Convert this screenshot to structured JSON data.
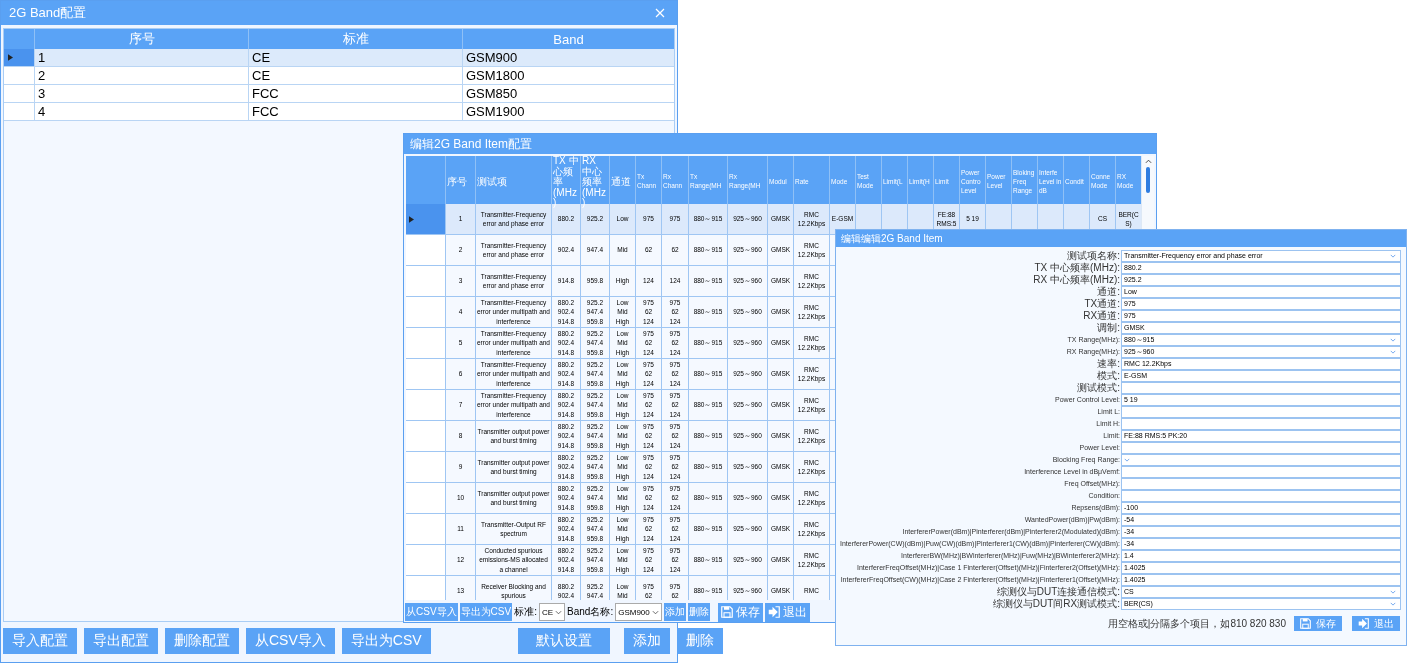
{
  "main_window": {
    "title": "2G Band配置",
    "table": {
      "columns": [
        "序号",
        "标准",
        "Band"
      ],
      "rows": [
        {
          "cells": [
            "1",
            "CE",
            "GSM900"
          ],
          "selected": true
        },
        {
          "cells": [
            "2",
            "CE",
            "GSM1800"
          ],
          "selected": false
        },
        {
          "cells": [
            "3",
            "FCC",
            "GSM850"
          ],
          "selected": false
        },
        {
          "cells": [
            "4",
            "FCC",
            "GSM1900"
          ],
          "selected": false
        }
      ]
    },
    "buttons": {
      "left": [
        "导入配置",
        "导出配置",
        "删除配置",
        "从CSV导入",
        "导出为CSV"
      ],
      "center": "默认设置",
      "right": [
        "添加",
        "删除"
      ]
    }
  },
  "item_window": {
    "title": "编辑2G Band Item配置",
    "table": {
      "columns": [
        "序号",
        "测试项",
        "TX 中心频率(MHz)",
        "RX 中心频率(MHz)",
        "通道",
        "Tx Chann",
        "Rx Chann",
        "Tx Range(MH",
        "Rx Range(MH",
        "Modul",
        "Rate",
        "Mode",
        "Test Mode",
        "Limit(L",
        "Limit(H",
        "Limit",
        "Power Contro Level",
        "Power Level",
        "Bloking Freq Range",
        "Interfe Level in dB",
        "Condit",
        "Conne Mode",
        "RX Mode"
      ],
      "rows": [
        {
          "selected": true,
          "cells": [
            "1",
            "Transmitter-Frequency error and phase error",
            "880.2",
            "925.2",
            "Low",
            "975",
            "975",
            "880～915",
            "925～960",
            "GMSK",
            "RMC 12.2Kbps",
            "E-GSM",
            null,
            null,
            null,
            "FE:88 RMS:5",
            "5 19",
            null,
            null,
            null,
            null,
            "CS",
            "BER(CS)"
          ]
        },
        {
          "selected": false,
          "cells": [
            "2",
            "Transmitter-Frequency error and phase error",
            "902.4",
            "947.4",
            "Mid",
            "62",
            "62",
            "880～915",
            "925～960",
            "GMSK",
            "RMC 12.2Kbps"
          ]
        },
        {
          "selected": false,
          "cells": [
            "3",
            "Transmitter-Frequency error and phase error",
            "914.8",
            "959.8",
            "High",
            "124",
            "124",
            "880～915",
            "925～960",
            "GMSK",
            "RMC 12.2Kbps"
          ]
        },
        {
          "selected": false,
          "cells": [
            "4",
            "Transmitter-Frequency error under multipath and interference",
            "880.2\n902.4\n914.8",
            "925.2\n947.4\n959.8",
            "Low\nMid\nHigh",
            "975\n62\n124",
            "975\n62\n124",
            "880～915",
            "925～960",
            "GMSK",
            "RMC 12.2Kbps"
          ]
        },
        {
          "selected": false,
          "cells": [
            "5",
            "Transmitter-Frequency error under multipath and interference",
            "880.2\n902.4\n914.8",
            "925.2\n947.4\n959.8",
            "Low\nMid\nHigh",
            "975\n62\n124",
            "975\n62\n124",
            "880～915",
            "925～960",
            "GMSK",
            "RMC 12.2Kbps"
          ]
        },
        {
          "selected": false,
          "cells": [
            "6",
            "Transmitter-Frequency error under multipath and interference",
            "880.2\n902.4\n914.8",
            "925.2\n947.4\n959.8",
            "Low\nMid\nHigh",
            "975\n62\n124",
            "975\n62\n124",
            "880～915",
            "925～960",
            "GMSK",
            "RMC 12.2Kbps"
          ]
        },
        {
          "selected": false,
          "cells": [
            "7",
            "Transmitter-Frequency error under multipath and interference",
            "880.2\n902.4\n914.8",
            "925.2\n947.4\n959.8",
            "Low\nMid\nHigh",
            "975\n62\n124",
            "975\n62\n124",
            "880～915",
            "925～960",
            "GMSK",
            "RMC 12.2Kbps"
          ]
        },
        {
          "selected": false,
          "cells": [
            "8",
            "Transmitter output power and burst timing",
            "880.2\n902.4\n914.8",
            "925.2\n947.4\n959.8",
            "Low\nMid\nHigh",
            "975\n62\n124",
            "975\n62\n124",
            "880～915",
            "925～960",
            "GMSK",
            "RMC 12.2Kbps"
          ]
        },
        {
          "selected": false,
          "cells": [
            "9",
            "Transmitter output power and burst timing",
            "880.2\n902.4\n914.8",
            "925.2\n947.4\n959.8",
            "Low\nMid\nHigh",
            "975\n62\n124",
            "975\n62\n124",
            "880～915",
            "925～960",
            "GMSK",
            "RMC 12.2Kbps"
          ]
        },
        {
          "selected": false,
          "cells": [
            "10",
            "Transmitter output power and burst timing",
            "880.2\n902.4\n914.8",
            "925.2\n947.4\n959.8",
            "Low\nMid\nHigh",
            "975\n62\n124",
            "975\n62\n124",
            "880～915",
            "925～960",
            "GMSK",
            "RMC 12.2Kbps"
          ]
        },
        {
          "selected": false,
          "cells": [
            "11",
            "Transmitter-Output RF spectrum",
            "880.2\n902.4\n914.8",
            "925.2\n947.4\n959.8",
            "Low\nMid\nHigh",
            "975\n62\n124",
            "975\n62\n124",
            "880～915",
            "925～960",
            "GMSK",
            "RMC 12.2Kbps"
          ]
        },
        {
          "selected": false,
          "cells": [
            "12",
            "Conducted spurious emissions-MS allocated a channel",
            "880.2\n902.4\n914.8",
            "925.2\n947.4\n959.8",
            "Low\nMid\nHigh",
            "975\n62\n124",
            "975\n62\n124",
            "880～915",
            "925～960",
            "GMSK",
            "RMC 12.2Kbps"
          ]
        },
        {
          "selected": false,
          "cells": [
            "13",
            "Receiver Blocking and spurious",
            "880.2\n902.4",
            "925.2\n947.4",
            "Low\nMid",
            "975\n62",
            "975\n62",
            "880～915",
            "925～960",
            "GMSK",
            "RMC"
          ]
        }
      ]
    },
    "toolbar": {
      "import_button": "从CSV导入",
      "export_button": "导出为CSV",
      "standard_label": "标准:",
      "standard_value": "CE",
      "band_label": "Band名称:",
      "band_value": "GSM900",
      "add_button": "添加",
      "delete_button": "删除",
      "save_button": "保存",
      "exit_button": "退出"
    }
  },
  "edit_dialog": {
    "title": "编辑编辑2G Band Item",
    "fields": [
      {
        "label": "测试项名称:",
        "value": "Transmitter-Frequency error and phase error",
        "kind": "select"
      },
      {
        "label": "TX 中心频率(MHz):",
        "value": "880.2",
        "kind": "input"
      },
      {
        "label": "RX 中心频率(MHz):",
        "value": "925.2",
        "kind": "input"
      },
      {
        "label": "通道:",
        "value": "Low",
        "kind": "input"
      },
      {
        "label": "TX通道:",
        "value": "975",
        "kind": "input"
      },
      {
        "label": "RX通道:",
        "value": "975",
        "kind": "input"
      },
      {
        "label": "调制:",
        "value": "GMSK",
        "kind": "input"
      },
      {
        "label": "TX Range(MHz):",
        "value": "880～915",
        "kind": "select"
      },
      {
        "label": "RX Range(MHz):",
        "value": "925～960",
        "kind": "select"
      },
      {
        "label": "速率:",
        "value": "RMC 12.2Kbps",
        "kind": "input"
      },
      {
        "label": "模式:",
        "value": "E-GSM",
        "kind": "input"
      },
      {
        "label": "测试模式:",
        "kind": "input"
      },
      {
        "label": "Power Control Level:",
        "value": "5 19",
        "kind": "input"
      },
      {
        "label": "Limit L:",
        "kind": "input"
      },
      {
        "label": "Limit H:",
        "kind": "input"
      },
      {
        "label": "Limit:",
        "value": "FE:88 RMS:5 PK:20",
        "kind": "input"
      },
      {
        "label": "Power Level:",
        "kind": "input"
      },
      {
        "label": "Blocking Freq Range:",
        "kind": "select"
      },
      {
        "label": "Interference Level in dBμVemf:",
        "kind": "input"
      },
      {
        "label": "Freq Offset(MHz):",
        "kind": "input"
      },
      {
        "label": "Condition:",
        "kind": "input"
      },
      {
        "label": "Repsens(dBm):",
        "value": "-100",
        "kind": "input"
      },
      {
        "label": "WantedPower(dBm)|Pw(dBm):",
        "value": "-54",
        "kind": "input"
      },
      {
        "label": "InterfererPower(dBm)|Pinterferer(dBm)|Pinterferer2(Modulated)(dBm):",
        "value": "-34",
        "kind": "input"
      },
      {
        "label": "InterfererPower(CW)(dBm)|Puw(CW)(dBm)|Pinterferer1(CW)(dBm)|Pinterferer(CW)(dBm):",
        "value": "-34",
        "kind": "input"
      },
      {
        "label": "InterfererBW(MHz)|BWinterferer(MHz)|Fuw(MHz)|BWinterferer2(MHz):",
        "value": "1.4",
        "kind": "input"
      },
      {
        "label": "InterfererFreqOffset(MHz)|Case 1 Finterferer(Offset)(MHz)|Finterferer2(Offset)(MHz):",
        "value": "1.4025",
        "kind": "input"
      },
      {
        "label": "InterfererFreqOffset(CW)(MHz)|Case 2 Finterferer(Offset)(MHz)|Finterferer1(Offset)(MHz):",
        "value": "1.4025",
        "kind": "input"
      },
      {
        "label": "综测仪与DUT连接通信模式:",
        "value": "CS",
        "kind": "select"
      },
      {
        "label": "综测仪与DUT间RX测试模式:",
        "value": "BER(CS)",
        "kind": "select"
      }
    ],
    "hint": "用空格或|分隔多个项目，如810 820 830",
    "save_button": "保存",
    "exit_button": "退出"
  }
}
